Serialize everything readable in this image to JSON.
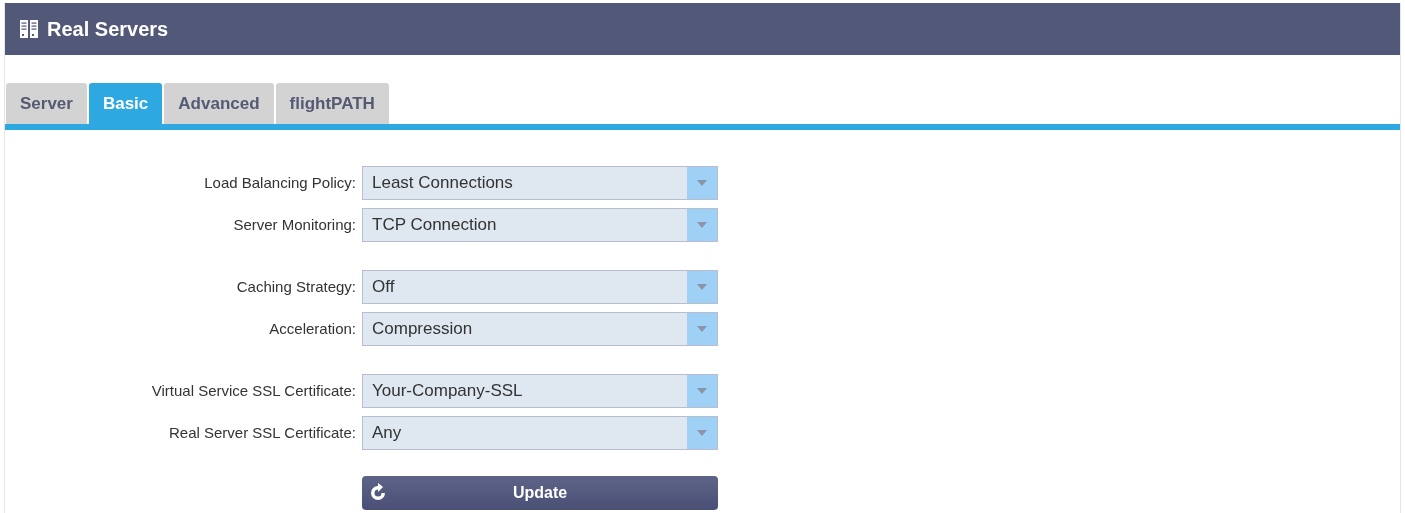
{
  "panel": {
    "title": "Real Servers"
  },
  "tabs": [
    {
      "label": "Server",
      "selected": false
    },
    {
      "label": "Basic",
      "selected": true
    },
    {
      "label": "Advanced",
      "selected": false
    },
    {
      "label": "flightPATH",
      "selected": false
    }
  ],
  "field_groups": [
    {
      "fields": [
        {
          "label": "Load Balancing Policy:",
          "value": "Least Connections"
        },
        {
          "label": "Server Monitoring:",
          "value": "TCP Connection"
        }
      ]
    },
    {
      "fields": [
        {
          "label": "Caching Strategy:",
          "value": "Off"
        },
        {
          "label": "Acceleration:",
          "value": "Compression"
        }
      ]
    },
    {
      "fields": [
        {
          "label": "Virtual Service SSL Certificate:",
          "value": "Your-Company-SSL"
        },
        {
          "label": "Real Server SSL Certificate:",
          "value": "Any"
        }
      ]
    }
  ],
  "update_button": {
    "label": "Update"
  }
}
